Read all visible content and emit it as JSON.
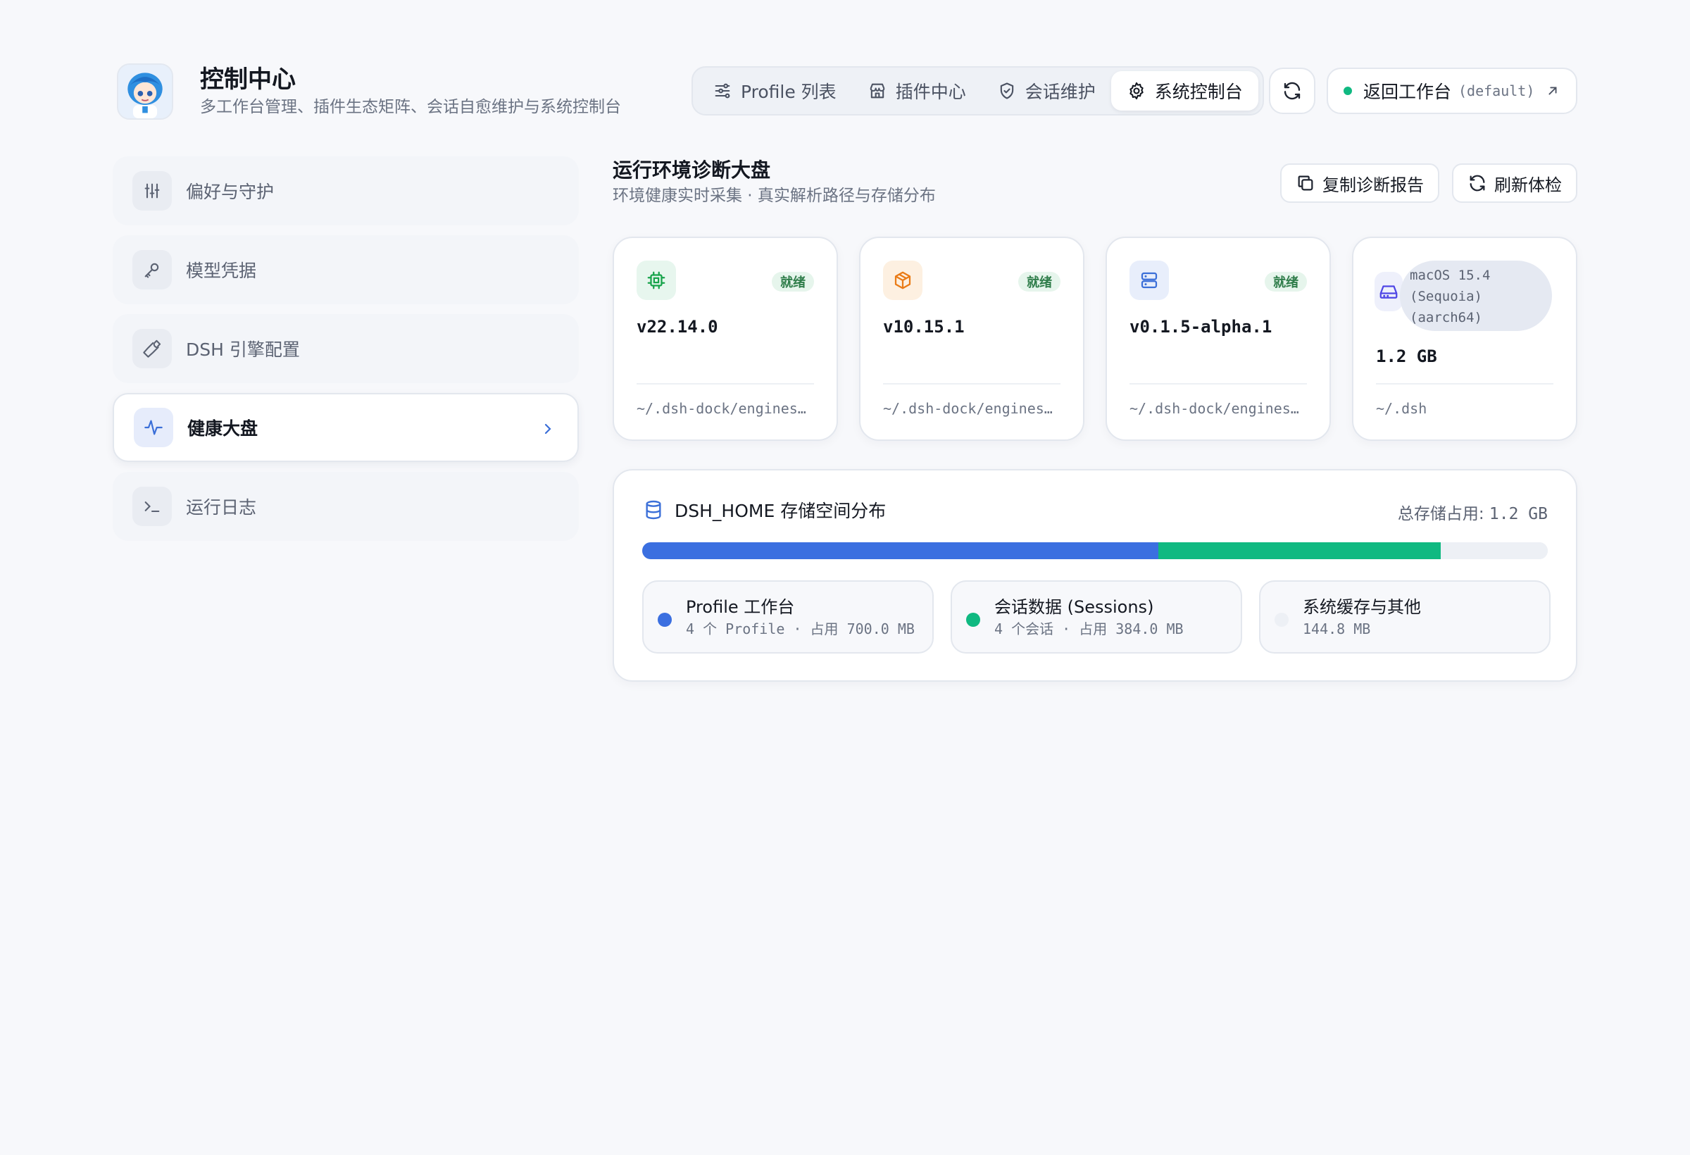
{
  "brand": {
    "title": "控制中心",
    "subtitle": "多工作台管理、插件生态矩阵、会话自愈维护与系统控制台"
  },
  "nav": {
    "tabs": [
      {
        "label": "Profile 列表",
        "icon": "sliders-icon",
        "active": false
      },
      {
        "label": "插件中心",
        "icon": "store-icon",
        "active": false
      },
      {
        "label": "会话维护",
        "icon": "shield-icon",
        "active": false
      },
      {
        "label": "系统控制台",
        "icon": "gear-icon",
        "active": true
      }
    ],
    "refresh_icon": "refresh-icon",
    "back": {
      "label": "返回工作台",
      "tag": "(default)",
      "icon": "arrow-up-right-icon",
      "status_color": "#10b981"
    }
  },
  "sidebar": {
    "items": [
      {
        "label": "偏好与守护",
        "icon": "sliders-vertical-icon",
        "active": false
      },
      {
        "label": "模型凭据",
        "icon": "key-icon",
        "active": false
      },
      {
        "label": "DSH 引擎配置",
        "icon": "wrench-icon",
        "active": false
      },
      {
        "label": "健康大盘",
        "icon": "activity-icon",
        "active": true
      },
      {
        "label": "运行日志",
        "icon": "terminal-icon",
        "active": false
      }
    ]
  },
  "main": {
    "title": "运行环境诊断大盘",
    "subtitle": "环境健康实时采集 · 真实解析路径与存储分布",
    "actions": {
      "copy_label": "复制诊断报告",
      "refresh_label": "刷新体检"
    },
    "cards": [
      {
        "icon": "cpu-icon",
        "icon_color": "#16a34a",
        "icon_bg": "#e7f6ee",
        "badge": "就绪",
        "version": "v22.14.0",
        "path": "~/.dsh-dock/engines/node"
      },
      {
        "icon": "package-icon",
        "icon_color": "#ea7b16",
        "icon_bg": "#fdf0e1",
        "badge": "就绪",
        "version": "v10.15.1",
        "path": "~/.dsh-dock/engines/pnpm"
      },
      {
        "icon": "server-icon",
        "icon_color": "#3b6fd8",
        "icon_bg": "#e8eefb",
        "badge": "就绪",
        "version": "v0.1.5-alpha.1",
        "path": "~/.dsh-dock/engines/dsh"
      }
    ],
    "os_card": {
      "icon": "hard-drive-icon",
      "os_lines": [
        "macOS 15.4",
        "(Sequoia)",
        "(aarch64)"
      ],
      "value": "1.2 GB",
      "path": "~/.dsh"
    },
    "storage": {
      "icon": "database-icon",
      "title": "DSH_HOME 存储空间分布",
      "total_label": "总存储占用:",
      "total_value": "1.2 GB",
      "segments": [
        {
          "name": "Profile 工作台",
          "desc": "4 个 Profile · 占用 700.0 MB",
          "mb": 700.0,
          "color": "#3b6fe0"
        },
        {
          "name": "会话数据 (Sessions)",
          "desc": "4 个会话 · 占用 384.0 MB",
          "mb": 384.0,
          "color": "#10b981"
        },
        {
          "name": "系统缓存与其他",
          "desc": "144.8 MB",
          "mb": 144.8,
          "color": "#edf0f5"
        }
      ]
    }
  }
}
